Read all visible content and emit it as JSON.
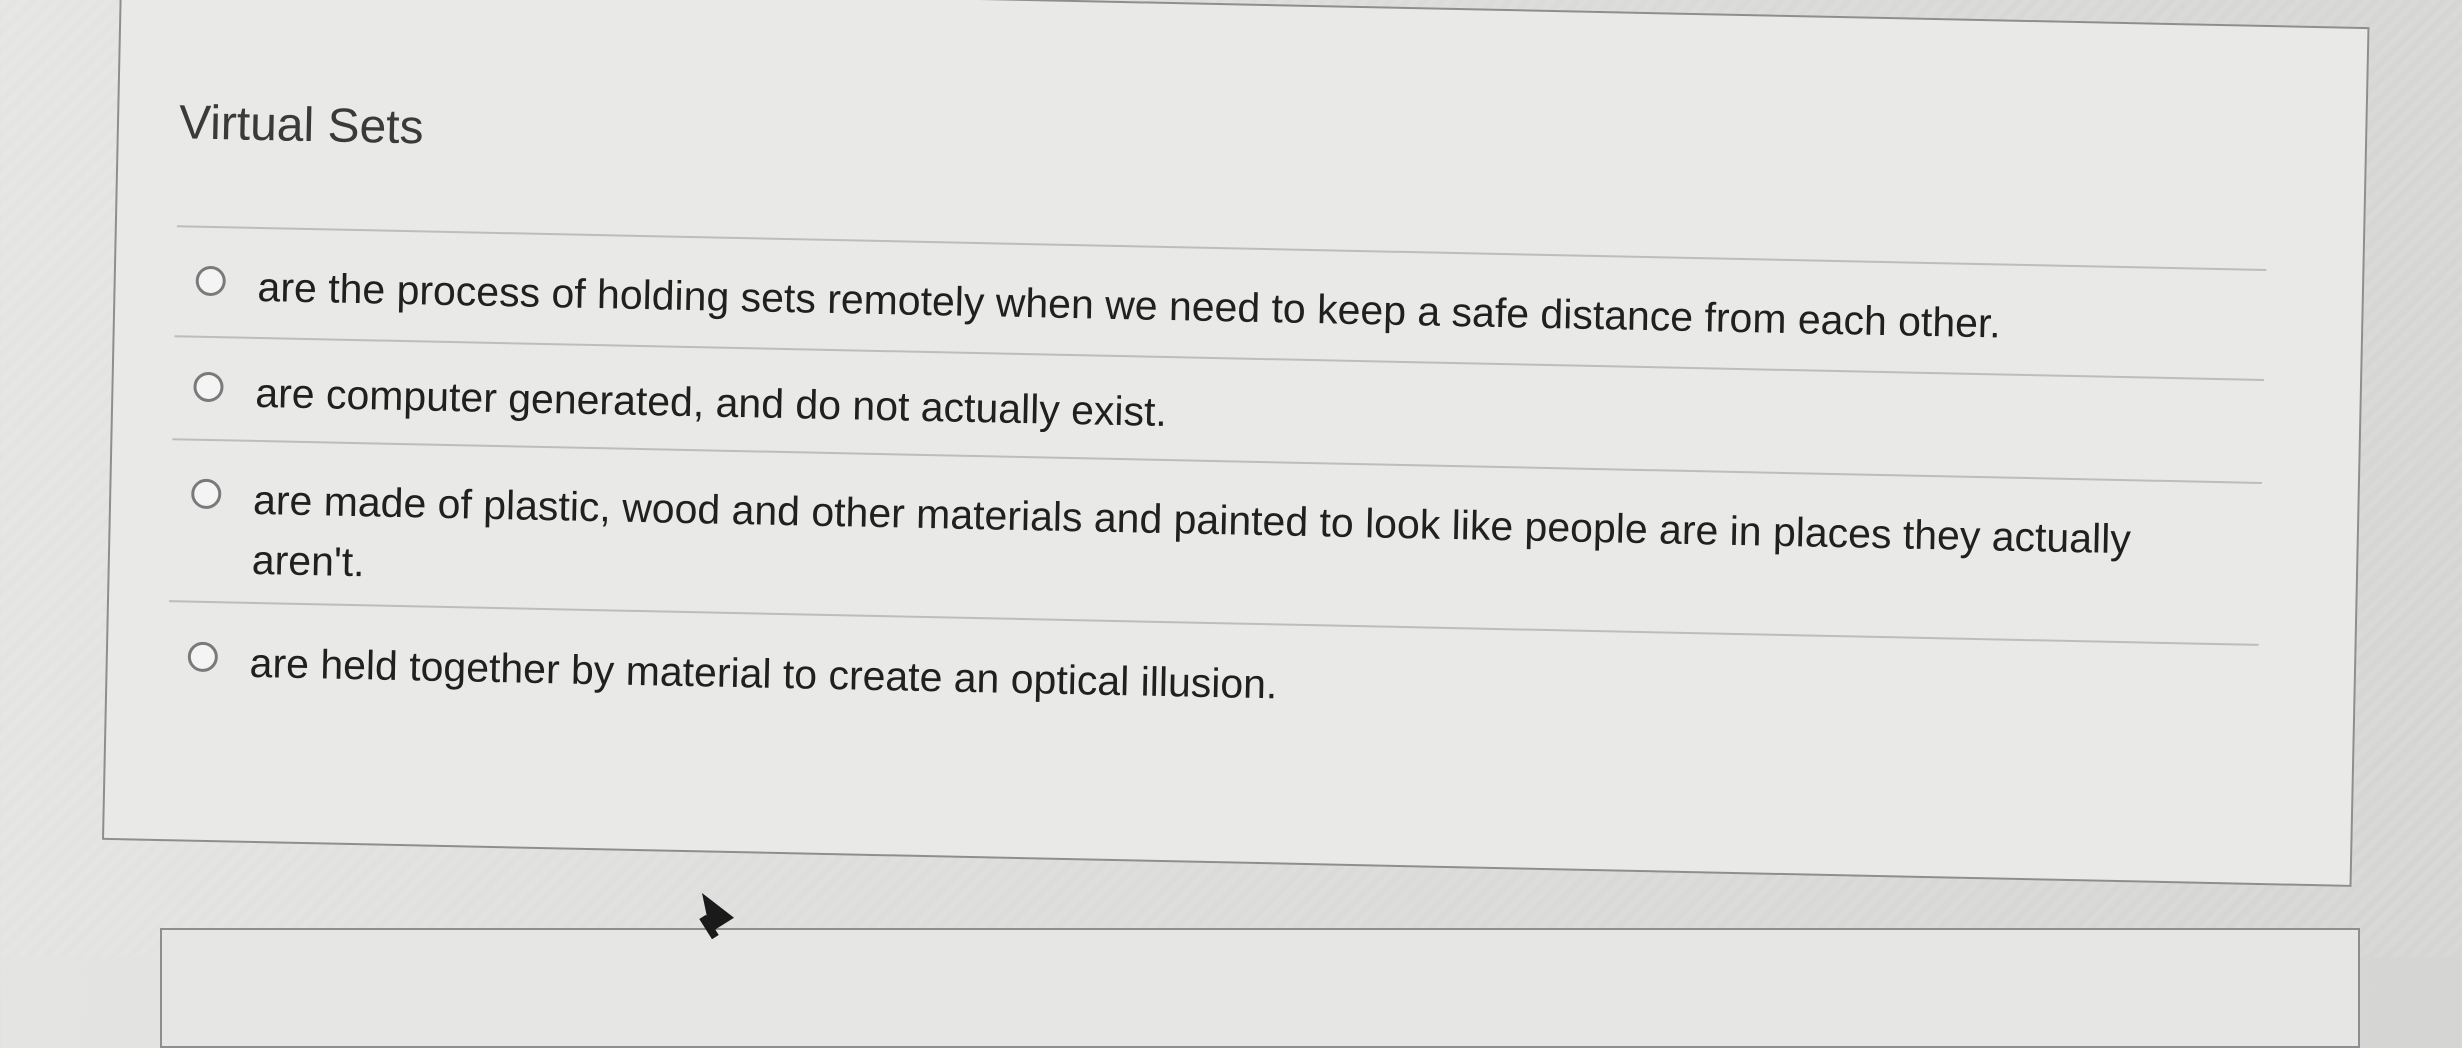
{
  "question": {
    "title": "Virtual Sets",
    "options": [
      {
        "label": "are the process of holding sets remotely when we need to keep a safe distance from each other."
      },
      {
        "label": "are computer generated, and do not actually exist."
      },
      {
        "label": "are made of plastic, wood and other materials and painted to look like people are in places they actually aren't."
      },
      {
        "label": "are held together by material to create an optical illusion."
      }
    ]
  },
  "icons": {
    "option_marker": "radio-button-icon",
    "pointer": "mouse-cursor-icon"
  },
  "colors": {
    "background": "#dcdcda",
    "card": "#e9e9e7",
    "text": "#202020",
    "border": "#8e8e8e"
  }
}
